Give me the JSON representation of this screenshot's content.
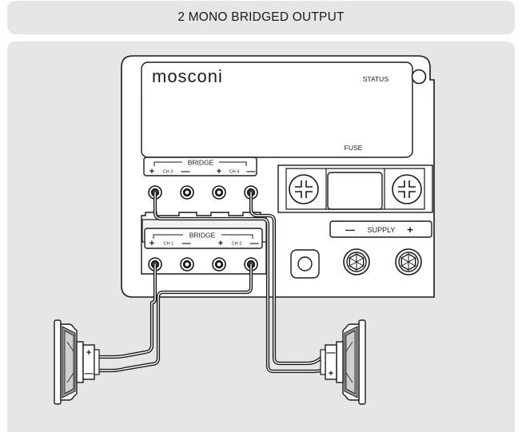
{
  "title": "2 MONO BRIDGED OUTPUT",
  "amplifier": {
    "brand_logo": "mosconi",
    "status_label": "STATUS",
    "fuse_label": "FUSE",
    "bridge_top": {
      "label": "BRIDGE",
      "ch_left": "CH 3",
      "ch_right": "CH 4",
      "plus": "+",
      "minus": "—"
    },
    "bridge_bottom": {
      "label": "BRIDGE",
      "ch_left": "CH 1",
      "ch_right": "CH 2",
      "plus": "+",
      "minus": "—"
    },
    "supply": {
      "label": "SUPPLY",
      "minus": "—",
      "plus": "+"
    }
  },
  "speakers": {
    "left": {
      "plus": "+",
      "minus": "—"
    },
    "right": {
      "minus": "—",
      "plus": "+"
    }
  },
  "colors": {
    "panel_bg": "#e6e6e6",
    "line": "#1a1a1a",
    "device_fill": "#ffffff"
  }
}
